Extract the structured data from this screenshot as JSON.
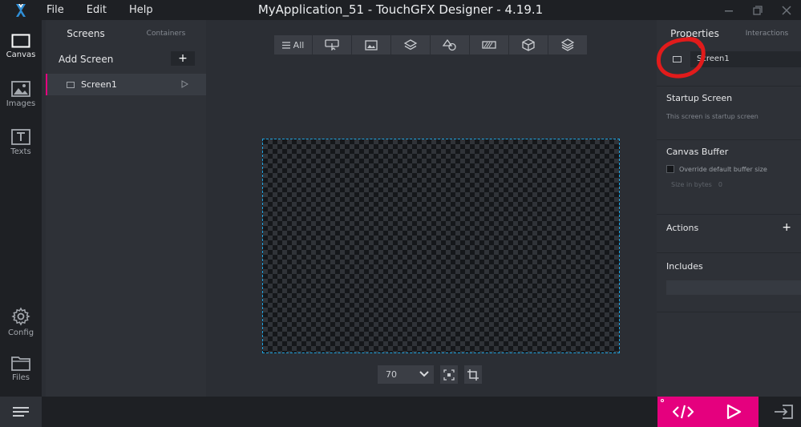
{
  "window": {
    "title": "MyApplication_51 - TouchGFX Designer - 4.19.1"
  },
  "menu": {
    "file": "File",
    "edit": "Edit",
    "help": "Help"
  },
  "rail": {
    "canvas": "Canvas",
    "images": "Images",
    "texts": "Texts",
    "config": "Config",
    "files": "Files"
  },
  "screens_panel": {
    "tab_screens": "Screens",
    "tab_containers": "Containers",
    "add_screen": "Add Screen",
    "add_symbol": "+",
    "items": [
      {
        "label": "Screen1"
      }
    ]
  },
  "toolbar": {
    "all_label": "All",
    "groups": [
      "all",
      "interaction-icon",
      "image-icon",
      "layers-icon",
      "shapes-icon",
      "progress-icon",
      "3d-box-icon",
      "stack-icon"
    ]
  },
  "zoom": {
    "value": "70"
  },
  "properties": {
    "tab_properties": "Properties",
    "tab_interactions": "Interactions",
    "screen_name": "Screen1",
    "startup_title": "Startup Screen",
    "startup_sub": "This screen is startup screen",
    "buffer_title": "Canvas Buffer",
    "override_label": "Override default buffer size",
    "size_label": "Size in bytes",
    "size_value": "0",
    "actions_title": "Actions",
    "includes_title": "Includes",
    "plus": "+"
  },
  "colors": {
    "accent": "#e5007e",
    "selection": "#1ea3e0",
    "annotation": "#e11b1b"
  }
}
